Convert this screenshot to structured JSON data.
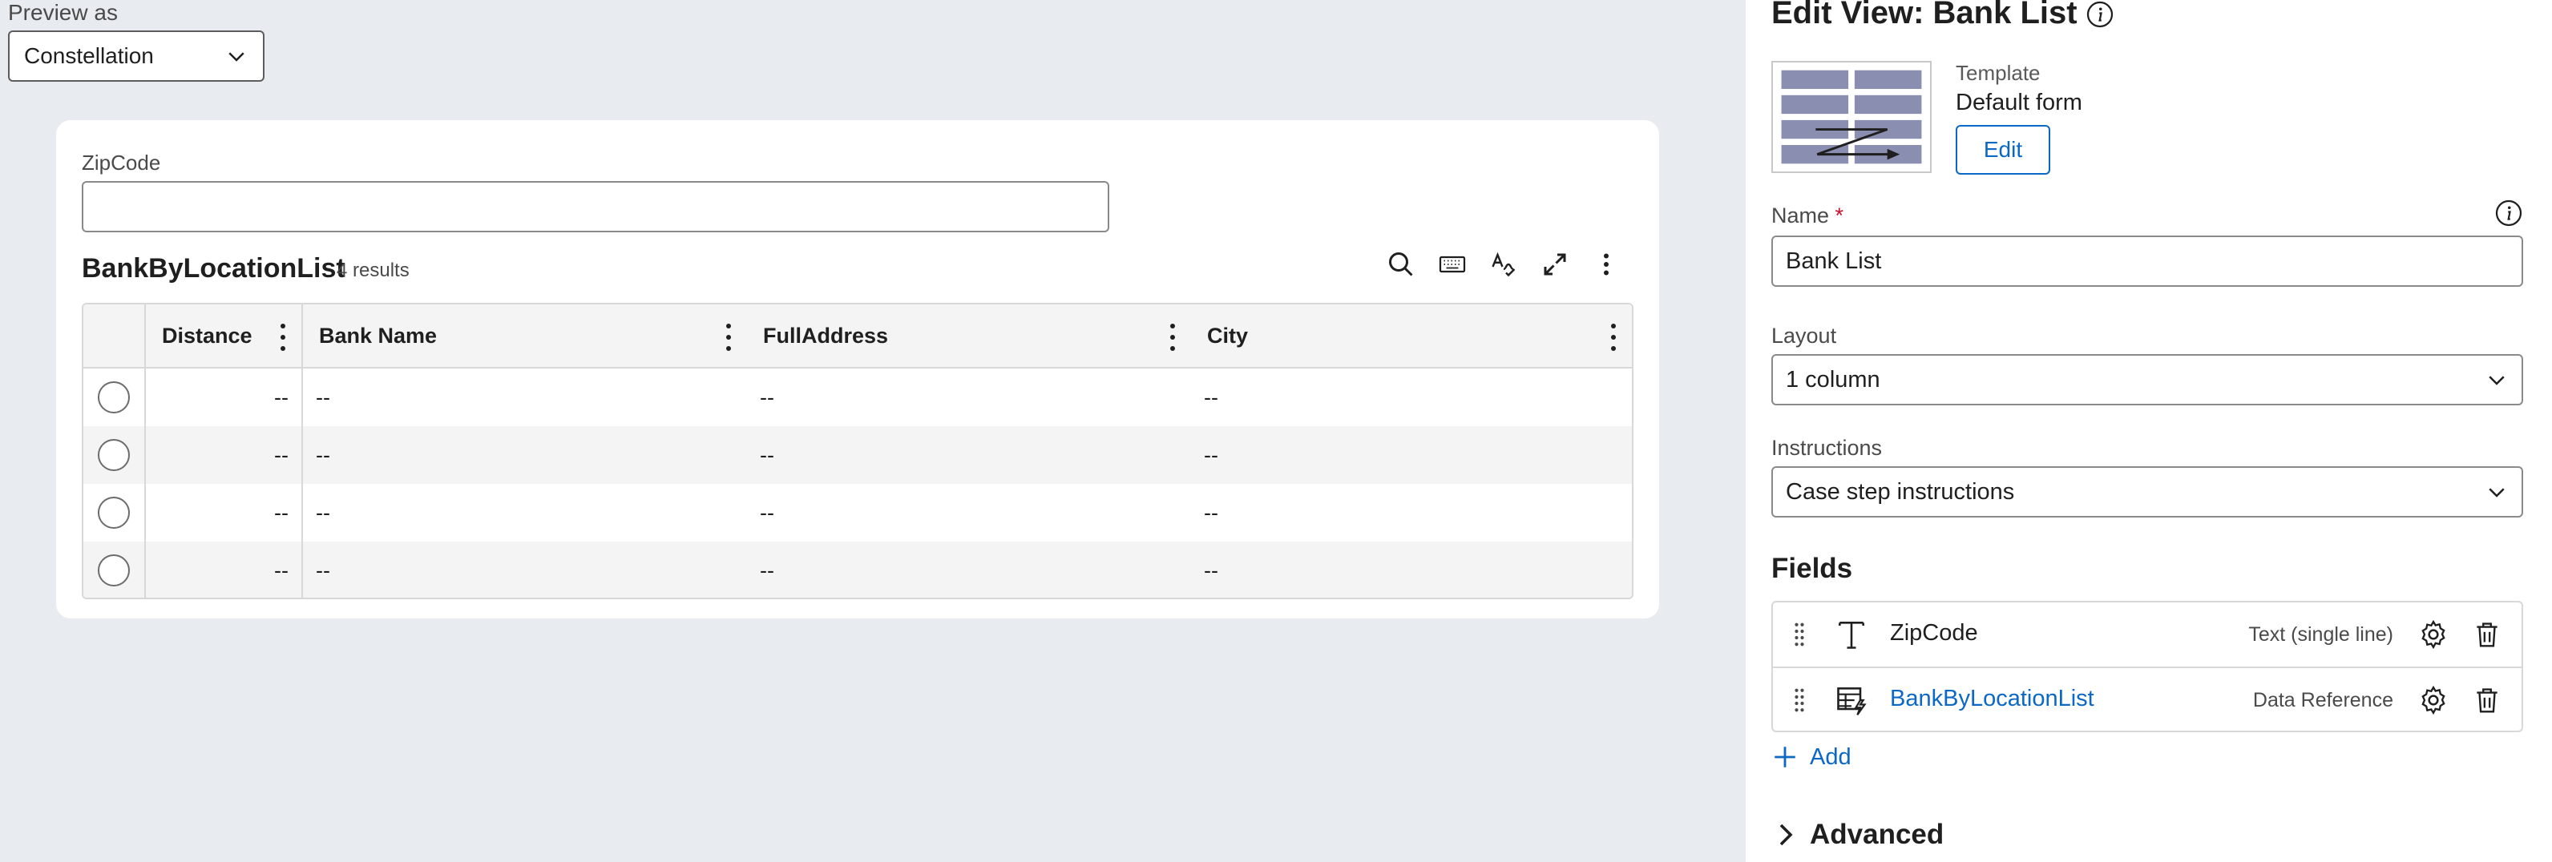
{
  "preview": {
    "label": "Preview as",
    "selected": "Constellation",
    "form": {
      "zip_label": "ZipCode",
      "zip_value": "",
      "list_title": "BankByLocationList",
      "list_count": "4 results",
      "columns": [
        "Distance",
        "Bank Name",
        "FullAddress",
        "City"
      ],
      "rows": [
        [
          "--",
          "--",
          "--",
          "--"
        ],
        [
          "--",
          "--",
          "--",
          "--"
        ],
        [
          "--",
          "--",
          "--",
          "--"
        ],
        [
          "--",
          "--",
          "--",
          "--"
        ]
      ],
      "tools": [
        "search-icon",
        "keyboard-icon",
        "spellcheck-icon",
        "expand-icon",
        "more-icon"
      ]
    }
  },
  "panel": {
    "title": "Edit View: Bank List",
    "template": {
      "label": "Template",
      "value": "Default form",
      "edit_label": "Edit"
    },
    "name": {
      "label": "Name",
      "required_mark": "*",
      "value": "Bank List"
    },
    "layout": {
      "label": "Layout",
      "value": "1 column"
    },
    "instructions": {
      "label": "Instructions",
      "value": "Case step instructions"
    },
    "fields_heading": "Fields",
    "fields": [
      {
        "name": "ZipCode",
        "type": "Text (single line)",
        "icon": "text-type-icon",
        "is_link": false
      },
      {
        "name": "BankByLocationList",
        "type": "Data Reference",
        "icon": "data-reference-icon",
        "is_link": true
      }
    ],
    "add_label": "Add",
    "advanced_label": "Advanced"
  },
  "colors": {
    "accent": "#0b68c4",
    "required": "#c8102e",
    "canvas": "#e8ebef"
  }
}
